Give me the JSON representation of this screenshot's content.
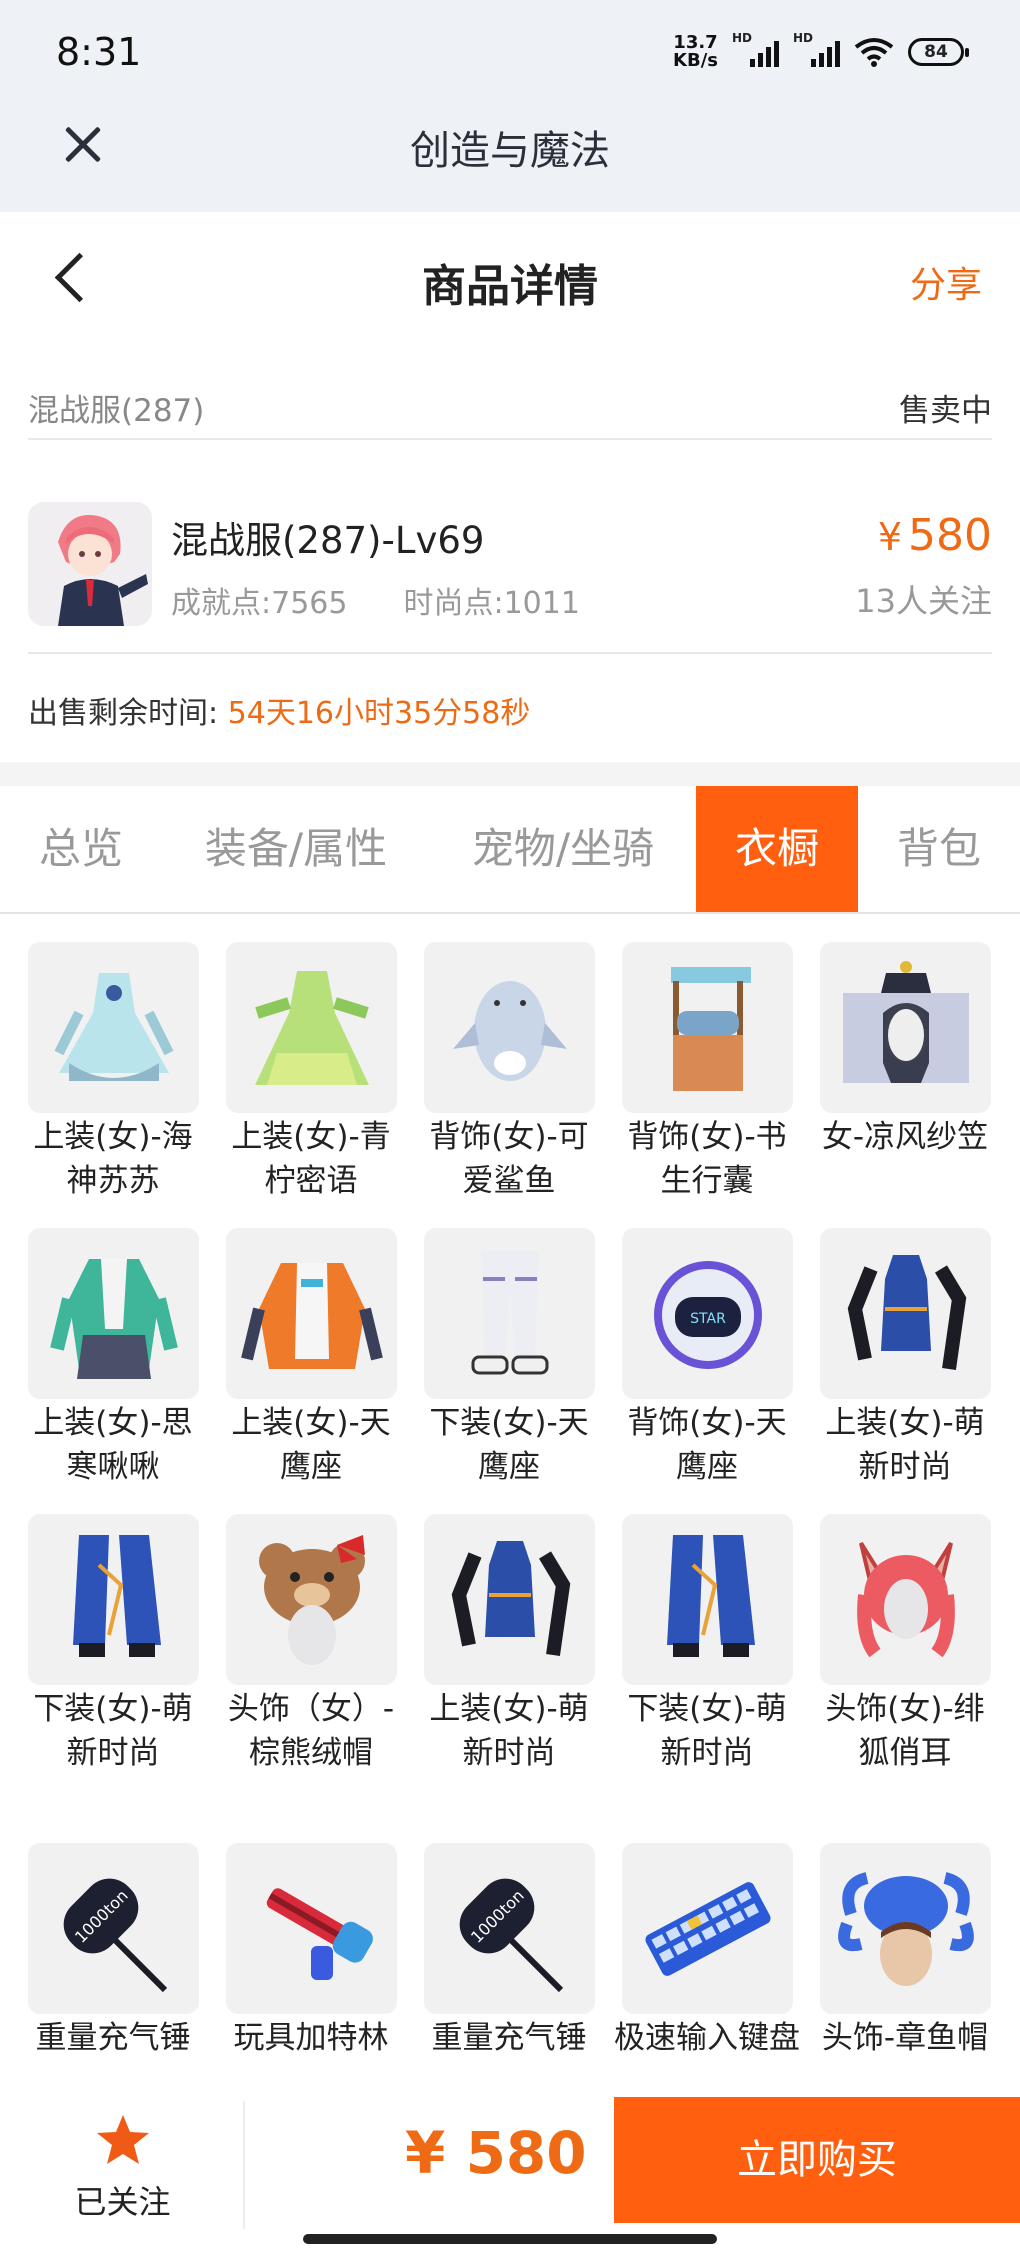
{
  "status": {
    "time": "8:31",
    "net_speed_value": "13.7",
    "net_speed_unit": "KB/s",
    "sim1": "HD",
    "sim2": "HD",
    "battery": "84"
  },
  "app": {
    "title": "创造与魔法"
  },
  "nav": {
    "title": "商品详情",
    "share": "分享"
  },
  "listing": {
    "server": "混战服(287)",
    "status": "售卖中",
    "name": "混战服(287)-Lv69",
    "achievement": "成就点:7565",
    "fashion": "时尚点:1011",
    "price_symbol": "¥",
    "price": "580",
    "followers": "13人关注",
    "remaining_label": "出售剩余时间:",
    "remaining_time": "54天16小时35分58秒"
  },
  "tabs": [
    {
      "label": "总览",
      "active": false
    },
    {
      "label": "装备/属性",
      "active": false
    },
    {
      "label": "宠物/坐骑",
      "active": false
    },
    {
      "label": "衣橱",
      "active": true
    },
    {
      "label": "背包",
      "active": false
    }
  ],
  "wardrobe": [
    {
      "label": "上装(女)-海神苏苏",
      "icon": "blue-dress-icon"
    },
    {
      "label": "上装(女)-青柠密语",
      "icon": "green-dress-icon"
    },
    {
      "label": "背饰(女)-可爱鲨鱼",
      "icon": "shark-backpack-icon"
    },
    {
      "label": "背饰(女)-书生行囊",
      "icon": "scholar-pack-icon"
    },
    {
      "label": "女-凉风纱笠",
      "icon": "veil-hat-icon"
    },
    {
      "label": "上装(女)-思寒啾啾",
      "icon": "green-jacket-icon"
    },
    {
      "label": "上装(女)-天鹰座",
      "icon": "orange-jacket-icon"
    },
    {
      "label": "下装(女)-天鹰座",
      "icon": "white-pants-icon"
    },
    {
      "label": "背饰(女)-天鹰座",
      "icon": "robot-pack-icon"
    },
    {
      "label": "上装(女)-萌新时尚",
      "icon": "blue-corset-icon"
    },
    {
      "label": "下装(女)-萌新时尚",
      "icon": "blue-skirt-icon"
    },
    {
      "label": "头饰（女）-棕熊绒帽",
      "icon": "bear-hat-icon"
    },
    {
      "label": "上装(女)-萌新时尚",
      "icon": "blue-corset-icon"
    },
    {
      "label": "下装(女)-萌新时尚",
      "icon": "blue-skirt-icon"
    },
    {
      "label": "头饰(女)-绯狐俏耳",
      "icon": "fox-ears-icon"
    },
    {
      "label": "重量充气锤",
      "icon": "hammer-icon"
    },
    {
      "label": "玩具加特林",
      "icon": "toy-gatling-icon"
    },
    {
      "label": "重量充气锤",
      "icon": "hammer-icon"
    },
    {
      "label": "极速输入键盘",
      "icon": "keyboard-icon"
    },
    {
      "label": "头饰-章鱼帽",
      "icon": "octopus-hat-icon"
    }
  ],
  "bottom": {
    "follow": "已关注",
    "price_symbol": "¥",
    "price": "580",
    "buy": "立即购买"
  },
  "colors": {
    "accent": "#ff5f0f",
    "price": "#ef6a14"
  }
}
